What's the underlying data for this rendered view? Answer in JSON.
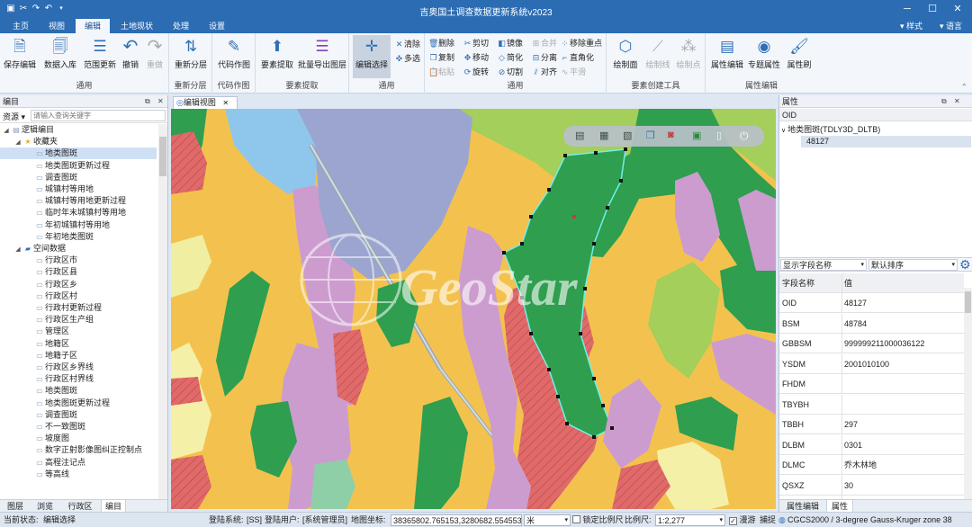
{
  "app": {
    "title": "吉奥国土调查数据更新系统v2023"
  },
  "quick_access": [
    "save-icon",
    "cut-icon",
    "redo-icon",
    "undo-icon",
    "dropdown-icon"
  ],
  "menu": {
    "tabs": [
      "主页",
      "视图",
      "编辑",
      "土地现状",
      "处理",
      "设置"
    ],
    "active": "编辑",
    "right": [
      "样式",
      "语言"
    ]
  },
  "ribbon": {
    "groups": [
      {
        "label": "通用",
        "buttons": [
          "保存编辑",
          "数据入库",
          "范围更新",
          "撤销",
          "重做"
        ]
      },
      {
        "label": "重新分层",
        "buttons": [
          "重新分层"
        ]
      },
      {
        "label": "代码作图",
        "buttons": [
          "代码作图"
        ]
      },
      {
        "label": "要素提取",
        "buttons": [
          "要素提取",
          "批量导出图层"
        ]
      },
      {
        "label": "通用",
        "buttons": [
          "编辑选择"
        ],
        "small": [
          "清除",
          "多选"
        ]
      },
      {
        "label": "通用",
        "small": [
          "删除",
          "复制",
          "粘贴",
          "剪切",
          "移动",
          "旋转",
          "镜像",
          "简化",
          "切割",
          "合并",
          "分离",
          "对齐",
          "移除重点",
          "直角化",
          "平滑"
        ]
      },
      {
        "label": "要素创建工具",
        "buttons": [
          "绘制面",
          "绘制线",
          "绘制点"
        ]
      },
      {
        "label": "属性编辑",
        "buttons": [
          "属性编辑",
          "专题属性",
          "属性刷"
        ]
      }
    ]
  },
  "left_panel": {
    "title": "编目",
    "search_label": "资源",
    "search_placeholder": "请输入查询关键字",
    "tree": [
      {
        "level": 0,
        "label": "逻辑编目",
        "type": "root"
      },
      {
        "level": 1,
        "label": "收藏夹",
        "type": "star"
      },
      {
        "level": 2,
        "label": "地类图斑",
        "type": "layer",
        "selected": true
      },
      {
        "level": 2,
        "label": "地类图斑更新过程",
        "type": "layer"
      },
      {
        "level": 2,
        "label": "调查图斑",
        "type": "layer"
      },
      {
        "level": 2,
        "label": "城镇村等用地",
        "type": "layer"
      },
      {
        "level": 2,
        "label": "城镇村等用地更新过程",
        "type": "layer"
      },
      {
        "level": 2,
        "label": "临时年末城镇村等用地",
        "type": "layer"
      },
      {
        "level": 2,
        "label": "年初城镇村等用地",
        "type": "layer"
      },
      {
        "level": 2,
        "label": "年初地类图斑",
        "type": "layer"
      },
      {
        "level": 1,
        "label": "空间数据",
        "type": "folder"
      },
      {
        "level": 2,
        "label": "行政区市",
        "type": "layer"
      },
      {
        "level": 2,
        "label": "行政区县",
        "type": "layer"
      },
      {
        "level": 2,
        "label": "行政区乡",
        "type": "layer"
      },
      {
        "level": 2,
        "label": "行政区村",
        "type": "layer"
      },
      {
        "level": 2,
        "label": "行政村更新过程",
        "type": "layer"
      },
      {
        "level": 2,
        "label": "行政区生产组",
        "type": "layer"
      },
      {
        "level": 2,
        "label": "管理区",
        "type": "layer"
      },
      {
        "level": 2,
        "label": "地籍区",
        "type": "layer"
      },
      {
        "level": 2,
        "label": "地籍子区",
        "type": "layer"
      },
      {
        "level": 2,
        "label": "行政区乡界线",
        "type": "layer"
      },
      {
        "level": 2,
        "label": "行政区村界线",
        "type": "layer"
      },
      {
        "level": 2,
        "label": "地类图斑",
        "type": "layer"
      },
      {
        "level": 2,
        "label": "地类图斑更新过程",
        "type": "layer"
      },
      {
        "level": 2,
        "label": "调查图斑",
        "type": "layer"
      },
      {
        "level": 2,
        "label": "不一致图斑",
        "type": "layer"
      },
      {
        "level": 2,
        "label": "坡度图",
        "type": "layer"
      },
      {
        "level": 2,
        "label": "数字正射影像图纠正控制点",
        "type": "layer"
      },
      {
        "level": 2,
        "label": "高程注记点",
        "type": "layer"
      },
      {
        "level": 2,
        "label": "等高线",
        "type": "layer"
      }
    ],
    "bottom_tabs": [
      "图层",
      "浏览",
      "行政区",
      "编目"
    ],
    "active_tab": "编目"
  },
  "map_view": {
    "tab": "编辑视图",
    "watermark": "GeoStar"
  },
  "right_panel": {
    "title": "属性",
    "tree_header": "OID",
    "layer": "地类图斑(TDLY3D_DLTB)",
    "oid": "48127",
    "field_select": "显示字段名称",
    "sort_select": "默认排序",
    "columns": [
      "字段名称",
      "值"
    ],
    "rows": [
      {
        "k": "OID",
        "v": "48127"
      },
      {
        "k": "BSM",
        "v": "48784"
      },
      {
        "k": "GBBSM",
        "v": "999999211000036122"
      },
      {
        "k": "YSDM",
        "v": "2001010100"
      },
      {
        "k": "FHDM",
        "v": ""
      },
      {
        "k": "TBYBH",
        "v": ""
      },
      {
        "k": "TBBH",
        "v": "297"
      },
      {
        "k": "DLBM",
        "v": "0301"
      },
      {
        "k": "DLMC",
        "v": "乔木林地"
      },
      {
        "k": "QSXZ",
        "v": "30"
      },
      {
        "k": "QSDWDM",
        "v": "9999991052020000000"
      }
    ],
    "bottom_tabs": [
      "属性编辑",
      "属性"
    ],
    "active_tab": "属性"
  },
  "status": {
    "state_label": "当前状态:",
    "state": "编辑选择",
    "system_label": "登陆系统:",
    "system": "[SS]",
    "user_label": "登陆用户:",
    "user": "[系统管理员]",
    "coord_label": "地图坐标:",
    "coord": "38365802.765153,3280682.554553",
    "unit": "米",
    "lock_scale": "锁定比例尺",
    "scale_label": "比例尺:",
    "scale": "1:2,277",
    "roam": "漫游",
    "snap": "捕捉",
    "crs": "CGCS2000 / 3-degree Gauss-Kruger zone 38"
  },
  "colors": {
    "accent": "#2b6cb3",
    "orchard": "#f3c24e",
    "forest": "#2f9e4f",
    "grass": "#a3cf5a",
    "urban": "#cc9ccf",
    "farmland": "#e06a6a",
    "water": "#8fc6ec",
    "building": "#9ba5cf"
  }
}
